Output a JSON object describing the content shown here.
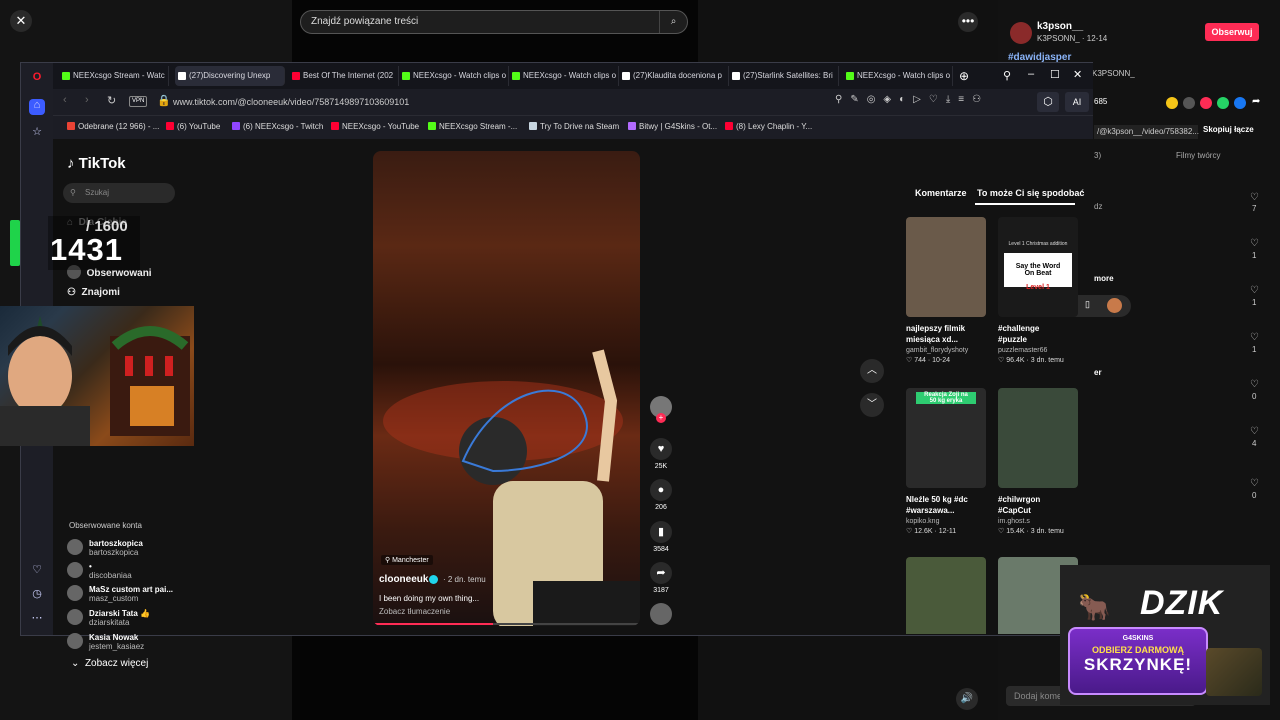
{
  "top": {
    "search_placeholder": "Znajdź powiązane treści",
    "close_glyph": "✕",
    "more_glyph": "•••"
  },
  "side_panel": {
    "username": "k3pson__",
    "sub": "K3PSONN_ · 12-14",
    "follow_label": "Obserwuj",
    "hashtag": "#dawidjasper",
    "handle2": "K3PSONN_",
    "saves": "685",
    "link": "/@k3pson__/video/758382...",
    "copy_label": "Skopiuj łącze",
    "creator_videos": "Filmy twórcy",
    "frag1": "3)",
    "frag2": "dz",
    "frag3": "more",
    "frag4": "er",
    "like_counts": [
      "7",
      "1",
      "1",
      "1",
      "0",
      "4",
      "0"
    ],
    "comment_placeholder": "Dodaj komentarz...",
    "comment_suffix": "@"
  },
  "browser": {
    "tabs": [
      {
        "label": "NEEXcsgo Stream - Watc",
        "color": "#53fc18"
      },
      {
        "label": "(27)Discovering Unexp",
        "color": "#ffffff"
      },
      {
        "label": "Best Of The Internet (202",
        "color": "#ff0033"
      },
      {
        "label": "NEEXcsgo - Watch clips o",
        "color": "#53fc18"
      },
      {
        "label": "NEEXcsgo - Watch clips o",
        "color": "#53fc18"
      },
      {
        "label": "(27)Klaudita doceniona p",
        "color": "#ffffff"
      },
      {
        "label": "(27)Starlink Satellites: Bri",
        "color": "#ffffff"
      },
      {
        "label": "NEEXcsgo - Watch clips o",
        "color": "#53fc18"
      }
    ],
    "vpn": "VPN",
    "url": "www.tiktok.com/@clooneeuk/video/7587149897103609101",
    "ai_label": "AI",
    "bookmarks": [
      {
        "label": "Odebrane (12 966) - ...",
        "color": "#ea4335"
      },
      {
        "label": "(6) YouTube",
        "color": "#ff0033"
      },
      {
        "label": "(6) NEEXcsgo - Twitch",
        "color": "#9146ff"
      },
      {
        "label": "NEEXcsgo - YouTube",
        "color": "#ff0033"
      },
      {
        "label": "NEEXcsgo Stream -...",
        "color": "#53fc18"
      },
      {
        "label": "Try To Drive na Steam",
        "color": "#c7d5e0"
      },
      {
        "label": "Bitwy | G4Skins - Ot...",
        "color": "#b36bff"
      },
      {
        "label": "(8) Lexy Chaplin - Y...",
        "color": "#ff0033"
      }
    ]
  },
  "tiktok": {
    "logo": "TikTok",
    "search_placeholder": "Szukaj",
    "nav": {
      "for_you": "Dla Ciebie",
      "following": "Obserwowani",
      "friends": "Znajomi"
    },
    "followed_heading": "Obserwowane konta",
    "accounts": [
      {
        "name": "bartoszkopica",
        "handle": "bartoszkopica"
      },
      {
        "name": "•",
        "handle": "discobaniaa"
      },
      {
        "name": "MaSz custom art pai...",
        "handle": "masz_custom"
      },
      {
        "name": "Dziarski Tata 👍",
        "handle": "dziarskitata"
      },
      {
        "name": "Kasia Nowak",
        "handle": "jestem_kasiaez"
      }
    ],
    "see_more": "Zobacz więcej",
    "video": {
      "location": "Manchester",
      "user": "clooneeuk",
      "time": "· 2 dn. temu",
      "desc": "I been doing my own thing...",
      "more": "Zobacz tłumaczenie",
      "progress": 0.45
    },
    "actions": {
      "likes": "25K",
      "comments": "206",
      "saves": "3584",
      "shares": "3187"
    },
    "right_tabs": {
      "comments": "Komentarze",
      "suggested": "To może Ci się spodobać"
    },
    "cards": [
      {
        "caption": "najlepszy filmik\nmiesiąca xd...",
        "author": "gambit_florydyshoty",
        "stats": "♡ 744 · 10-24",
        "color": "#6a5a4a"
      },
      {
        "caption": "#challenge\n#puzzle",
        "author": "puzzlemaster66",
        "stats": "♡ 96.4K · 3 dn. temu",
        "color": "#1a1a1a"
      },
      {
        "caption": "Nleźle 50 kg #dc\n#warszawa...",
        "author": "kopiko.kng",
        "stats": "♡ 12.6K · 12-11",
        "color": "#2a2a2a"
      },
      {
        "caption": "#chilwrgon\n#CapCut",
        "author": "im.ghost.s",
        "stats": "♡ 15.4K · 3 dn. temu",
        "color": "#3a4a3a"
      },
      {
        "caption": "",
        "author": "",
        "stats": "",
        "color": "#4a5a3a"
      },
      {
        "caption": "",
        "author": "",
        "stats": "",
        "color": "#6a7a6a"
      }
    ],
    "thumb_text": {
      "puzzle_top": "Level 1 Christmas addition",
      "puzzle_main": "Say the Word\nOn Beat",
      "puzzle_level": "Level 1",
      "reakcja": "Reakcja Zoji na\n50 kg eryka"
    }
  },
  "overlay": {
    "score": "1431",
    "score_max": "/ 1600",
    "dzik": "DZIK",
    "promo_brand": "G4SKINS",
    "promo_line1": "ODBIERZ DARMOWĄ",
    "promo_line2": "SKRZYNKĘ!"
  }
}
